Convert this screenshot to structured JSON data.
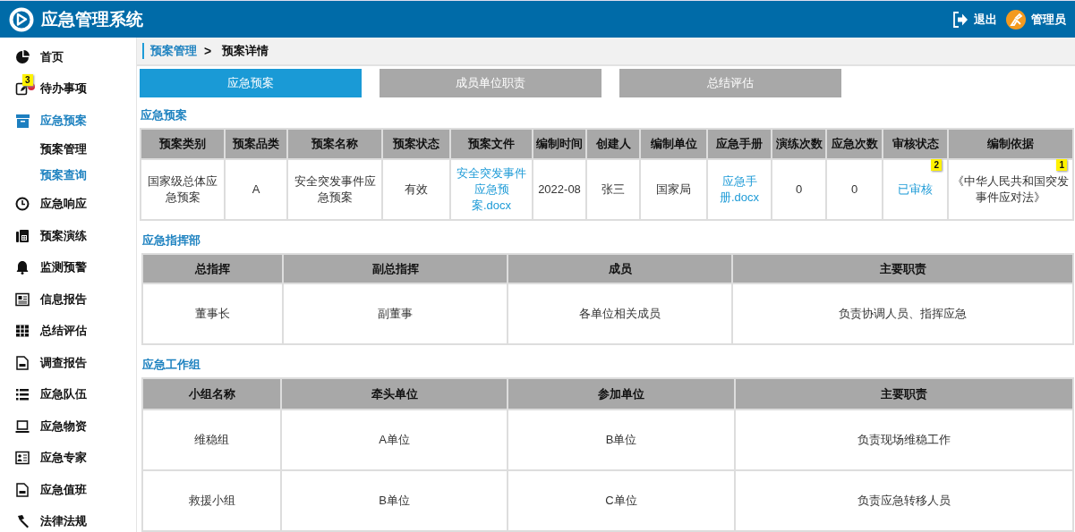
{
  "header": {
    "title": "应急管理系统",
    "logout": "退出",
    "user": "管理员"
  },
  "sidebar": {
    "items": [
      {
        "label": "首页",
        "selected": false
      },
      {
        "label": "待办事项",
        "selected": false,
        "badge": "3"
      },
      {
        "label": "应急预案",
        "selected": true,
        "children": [
          {
            "label": "预案管理",
            "selected": false
          },
          {
            "label": "预案查询",
            "selected": true
          }
        ]
      },
      {
        "label": "应急响应",
        "selected": false
      },
      {
        "label": "预案演练",
        "selected": false
      },
      {
        "label": "监测预警",
        "selected": false
      },
      {
        "label": "信息报告",
        "selected": false
      },
      {
        "label": "总结评估",
        "selected": false
      },
      {
        "label": "调查报告",
        "selected": false
      },
      {
        "label": "应急队伍",
        "selected": false
      },
      {
        "label": "应急物资",
        "selected": false
      },
      {
        "label": "应急专家",
        "selected": false
      },
      {
        "label": "应急值班",
        "selected": false
      },
      {
        "label": "法律法规",
        "selected": false
      }
    ]
  },
  "breadcrumb": {
    "parent": "预案管理",
    "separator": ">",
    "current": "预案详情"
  },
  "tabs": [
    {
      "label": "应急预案",
      "selected": true
    },
    {
      "label": "成员单位职责",
      "selected": false
    },
    {
      "label": "总结评估",
      "selected": false
    }
  ],
  "sections": [
    {
      "title": "应急预案",
      "table": {
        "columns": [
          "预案类别",
          "预案品类",
          "预案名称",
          "预案状态",
          "预案文件",
          "编制时间",
          "创建人",
          "编制单位",
          "应急手册",
          "演练次数",
          "应急次数",
          "审核状态",
          "编制依据"
        ],
        "rows": [
          [
            {
              "text": "国家级总体应急预案"
            },
            {
              "text": "A"
            },
            {
              "text": "安全突发事件应急预案"
            },
            {
              "text": "有效"
            },
            {
              "text": "安全突发事件应急预案.docx",
              "kind": "link"
            },
            {
              "text": "2022-08"
            },
            {
              "text": "张三"
            },
            {
              "text": "国家局"
            },
            {
              "text": "应急手册.docx",
              "kind": "link"
            },
            {
              "text": "0"
            },
            {
              "text": "0"
            },
            {
              "text": "已审核",
              "kind": "link",
              "badge": "2"
            },
            {
              "text": "《中华人民共和国突发事件应对法》",
              "badge": "1"
            }
          ]
        ]
      }
    },
    {
      "title": "应急指挥部",
      "table": {
        "columns": [
          "总指挥",
          "副总指挥",
          "成员",
          "主要职责"
        ],
        "rows": [
          [
            {
              "text": "董事长"
            },
            {
              "text": "副董事"
            },
            {
              "text": "各单位相关成员"
            },
            {
              "text": "负责协调人员、指挥应急"
            }
          ]
        ]
      }
    },
    {
      "title": "应急工作组",
      "table": {
        "columns": [
          "小组名称",
          "牵头单位",
          "参加单位",
          "主要职责"
        ],
        "rows": [
          [
            {
              "text": "维稳组"
            },
            {
              "text": "A单位"
            },
            {
              "text": "B单位"
            },
            {
              "text": "负责现场维稳工作"
            }
          ],
          [
            {
              "text": "救援小组"
            },
            {
              "text": "B单位"
            },
            {
              "text": "C单位"
            },
            {
              "text": "负责应急转移人员"
            }
          ]
        ]
      }
    }
  ]
}
